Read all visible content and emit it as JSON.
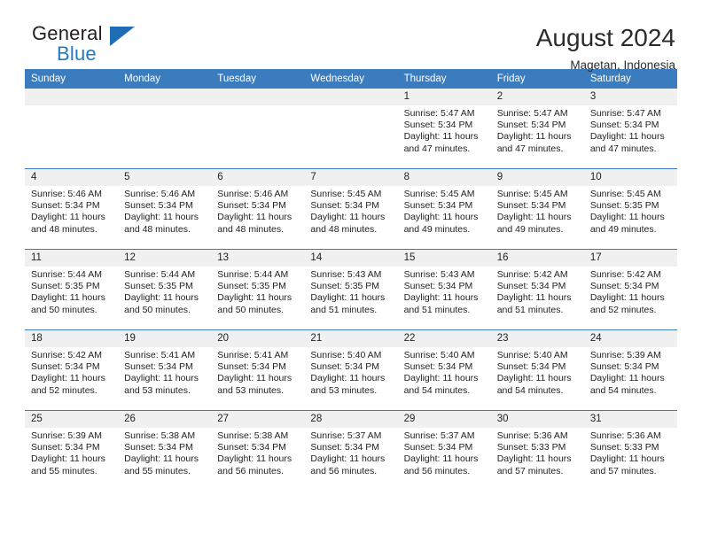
{
  "brand": {
    "name_part1": "General",
    "name_part2": "Blue",
    "logo_icon": "triangle-logo-icon"
  },
  "header": {
    "month_title": "August 2024",
    "location": "Magetan, Indonesia"
  },
  "colors": {
    "header_blue": "#3a7cbe",
    "brand_blue": "#1f7ac4",
    "daynum_background": "#f0f0f0",
    "text": "#222222"
  },
  "calendar": {
    "day_headers": [
      "Sunday",
      "Monday",
      "Tuesday",
      "Wednesday",
      "Thursday",
      "Friday",
      "Saturday"
    ],
    "weeks": [
      [
        {
          "day": "",
          "empty": true,
          "sunrise": "",
          "sunset": "",
          "daylight_line1": "",
          "daylight_line2": ""
        },
        {
          "day": "",
          "empty": true,
          "sunrise": "",
          "sunset": "",
          "daylight_line1": "",
          "daylight_line2": ""
        },
        {
          "day": "",
          "empty": true,
          "sunrise": "",
          "sunset": "",
          "daylight_line1": "",
          "daylight_line2": ""
        },
        {
          "day": "",
          "empty": true,
          "sunrise": "",
          "sunset": "",
          "daylight_line1": "",
          "daylight_line2": ""
        },
        {
          "day": "1",
          "sunrise": "Sunrise: 5:47 AM",
          "sunset": "Sunset: 5:34 PM",
          "daylight_line1": "Daylight: 11 hours",
          "daylight_line2": "and 47 minutes."
        },
        {
          "day": "2",
          "sunrise": "Sunrise: 5:47 AM",
          "sunset": "Sunset: 5:34 PM",
          "daylight_line1": "Daylight: 11 hours",
          "daylight_line2": "and 47 minutes."
        },
        {
          "day": "3",
          "sunrise": "Sunrise: 5:47 AM",
          "sunset": "Sunset: 5:34 PM",
          "daylight_line1": "Daylight: 11 hours",
          "daylight_line2": "and 47 minutes."
        }
      ],
      [
        {
          "day": "4",
          "sunrise": "Sunrise: 5:46 AM",
          "sunset": "Sunset: 5:34 PM",
          "daylight_line1": "Daylight: 11 hours",
          "daylight_line2": "and 48 minutes."
        },
        {
          "day": "5",
          "sunrise": "Sunrise: 5:46 AM",
          "sunset": "Sunset: 5:34 PM",
          "daylight_line1": "Daylight: 11 hours",
          "daylight_line2": "and 48 minutes."
        },
        {
          "day": "6",
          "sunrise": "Sunrise: 5:46 AM",
          "sunset": "Sunset: 5:34 PM",
          "daylight_line1": "Daylight: 11 hours",
          "daylight_line2": "and 48 minutes."
        },
        {
          "day": "7",
          "sunrise": "Sunrise: 5:45 AM",
          "sunset": "Sunset: 5:34 PM",
          "daylight_line1": "Daylight: 11 hours",
          "daylight_line2": "and 48 minutes."
        },
        {
          "day": "8",
          "sunrise": "Sunrise: 5:45 AM",
          "sunset": "Sunset: 5:34 PM",
          "daylight_line1": "Daylight: 11 hours",
          "daylight_line2": "and 49 minutes."
        },
        {
          "day": "9",
          "sunrise": "Sunrise: 5:45 AM",
          "sunset": "Sunset: 5:34 PM",
          "daylight_line1": "Daylight: 11 hours",
          "daylight_line2": "and 49 minutes."
        },
        {
          "day": "10",
          "sunrise": "Sunrise: 5:45 AM",
          "sunset": "Sunset: 5:35 PM",
          "daylight_line1": "Daylight: 11 hours",
          "daylight_line2": "and 49 minutes."
        }
      ],
      [
        {
          "day": "11",
          "sunrise": "Sunrise: 5:44 AM",
          "sunset": "Sunset: 5:35 PM",
          "daylight_line1": "Daylight: 11 hours",
          "daylight_line2": "and 50 minutes."
        },
        {
          "day": "12",
          "sunrise": "Sunrise: 5:44 AM",
          "sunset": "Sunset: 5:35 PM",
          "daylight_line1": "Daylight: 11 hours",
          "daylight_line2": "and 50 minutes."
        },
        {
          "day": "13",
          "sunrise": "Sunrise: 5:44 AM",
          "sunset": "Sunset: 5:35 PM",
          "daylight_line1": "Daylight: 11 hours",
          "daylight_line2": "and 50 minutes."
        },
        {
          "day": "14",
          "sunrise": "Sunrise: 5:43 AM",
          "sunset": "Sunset: 5:35 PM",
          "daylight_line1": "Daylight: 11 hours",
          "daylight_line2": "and 51 minutes."
        },
        {
          "day": "15",
          "sunrise": "Sunrise: 5:43 AM",
          "sunset": "Sunset: 5:34 PM",
          "daylight_line1": "Daylight: 11 hours",
          "daylight_line2": "and 51 minutes."
        },
        {
          "day": "16",
          "sunrise": "Sunrise: 5:42 AM",
          "sunset": "Sunset: 5:34 PM",
          "daylight_line1": "Daylight: 11 hours",
          "daylight_line2": "and 51 minutes."
        },
        {
          "day": "17",
          "sunrise": "Sunrise: 5:42 AM",
          "sunset": "Sunset: 5:34 PM",
          "daylight_line1": "Daylight: 11 hours",
          "daylight_line2": "and 52 minutes."
        }
      ],
      [
        {
          "day": "18",
          "sunrise": "Sunrise: 5:42 AM",
          "sunset": "Sunset: 5:34 PM",
          "daylight_line1": "Daylight: 11 hours",
          "daylight_line2": "and 52 minutes."
        },
        {
          "day": "19",
          "sunrise": "Sunrise: 5:41 AM",
          "sunset": "Sunset: 5:34 PM",
          "daylight_line1": "Daylight: 11 hours",
          "daylight_line2": "and 53 minutes."
        },
        {
          "day": "20",
          "sunrise": "Sunrise: 5:41 AM",
          "sunset": "Sunset: 5:34 PM",
          "daylight_line1": "Daylight: 11 hours",
          "daylight_line2": "and 53 minutes."
        },
        {
          "day": "21",
          "sunrise": "Sunrise: 5:40 AM",
          "sunset": "Sunset: 5:34 PM",
          "daylight_line1": "Daylight: 11 hours",
          "daylight_line2": "and 53 minutes."
        },
        {
          "day": "22",
          "sunrise": "Sunrise: 5:40 AM",
          "sunset": "Sunset: 5:34 PM",
          "daylight_line1": "Daylight: 11 hours",
          "daylight_line2": "and 54 minutes."
        },
        {
          "day": "23",
          "sunrise": "Sunrise: 5:40 AM",
          "sunset": "Sunset: 5:34 PM",
          "daylight_line1": "Daylight: 11 hours",
          "daylight_line2": "and 54 minutes."
        },
        {
          "day": "24",
          "sunrise": "Sunrise: 5:39 AM",
          "sunset": "Sunset: 5:34 PM",
          "daylight_line1": "Daylight: 11 hours",
          "daylight_line2": "and 54 minutes."
        }
      ],
      [
        {
          "day": "25",
          "sunrise": "Sunrise: 5:39 AM",
          "sunset": "Sunset: 5:34 PM",
          "daylight_line1": "Daylight: 11 hours",
          "daylight_line2": "and 55 minutes."
        },
        {
          "day": "26",
          "sunrise": "Sunrise: 5:38 AM",
          "sunset": "Sunset: 5:34 PM",
          "daylight_line1": "Daylight: 11 hours",
          "daylight_line2": "and 55 minutes."
        },
        {
          "day": "27",
          "sunrise": "Sunrise: 5:38 AM",
          "sunset": "Sunset: 5:34 PM",
          "daylight_line1": "Daylight: 11 hours",
          "daylight_line2": "and 56 minutes."
        },
        {
          "day": "28",
          "sunrise": "Sunrise: 5:37 AM",
          "sunset": "Sunset: 5:34 PM",
          "daylight_line1": "Daylight: 11 hours",
          "daylight_line2": "and 56 minutes."
        },
        {
          "day": "29",
          "sunrise": "Sunrise: 5:37 AM",
          "sunset": "Sunset: 5:34 PM",
          "daylight_line1": "Daylight: 11 hours",
          "daylight_line2": "and 56 minutes."
        },
        {
          "day": "30",
          "sunrise": "Sunrise: 5:36 AM",
          "sunset": "Sunset: 5:33 PM",
          "daylight_line1": "Daylight: 11 hours",
          "daylight_line2": "and 57 minutes."
        },
        {
          "day": "31",
          "sunrise": "Sunrise: 5:36 AM",
          "sunset": "Sunset: 5:33 PM",
          "daylight_line1": "Daylight: 11 hours",
          "daylight_line2": "and 57 minutes."
        }
      ]
    ]
  }
}
